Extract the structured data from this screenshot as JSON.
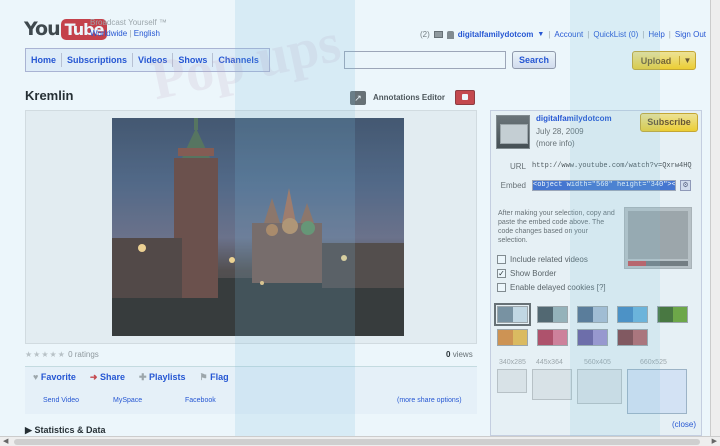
{
  "header": {
    "logo_you": "You",
    "logo_tube": "Tube",
    "tagline": "Broadcast Yourself ™",
    "locale": "Worldwide",
    "language": "English",
    "mail_count": "(2)",
    "username": "digitalfamilydotcom",
    "links": [
      "Account",
      "QuickList (0)",
      "Help",
      "Sign Out"
    ]
  },
  "nav": {
    "items": [
      "Home",
      "Subscriptions",
      "Videos",
      "Shows",
      "Channels"
    ],
    "search_placeholder": "",
    "search_label": "Search",
    "upload_label": "Upload"
  },
  "video": {
    "title": "Kremlin",
    "annotations_label": "Annotations Editor",
    "ratings": "0 ratings",
    "views_count": "0",
    "views_label": "views",
    "actions": [
      "Favorite",
      "Share",
      "Playlists",
      "Flag"
    ],
    "share_targets": [
      "Send Video",
      "MySpace",
      "Facebook"
    ],
    "more_share": "(more share options)",
    "statistics_label": "Statistics & Data"
  },
  "sidebar": {
    "owner": "digitalfamilydotcom",
    "date": "July 28, 2009",
    "more_info": "(more info)",
    "subscribe_label": "Subscribe",
    "url_label": "URL",
    "url_value": "http://www.youtube.com/watch?v=Qxrw4HQ",
    "embed_label": "Embed",
    "embed_value": "<object width=\"560\" height=\"340\"><param",
    "help_text": "After making your selection, copy and paste the embed code above. The code changes based on your selection.",
    "options": [
      {
        "label": "Include related videos",
        "checked": false
      },
      {
        "label": "Show Border",
        "checked": true
      },
      {
        "label": "Enable delayed cookies [?]",
        "checked": false
      }
    ],
    "swatches": [
      [
        "#6b7f8e",
        "#c8d8e0"
      ],
      [
        "#3a4a50",
        "#8fa8ac"
      ],
      [
        "#3e5475",
        "#a9b7cc"
      ],
      [
        "#2a74b8",
        "#58a8d8"
      ],
      [
        "#2f5e12",
        "#5d9a1c"
      ],
      [
        "#d8802a",
        "#e8b23a"
      ],
      [
        "#b02e48",
        "#d86a84"
      ],
      [
        "#5b3e8c",
        "#9c7ec4"
      ],
      [
        "#7a1e1e",
        "#b84a4a"
      ]
    ],
    "sizes": [
      "340x285",
      "445x364",
      "560x405",
      "660x525"
    ],
    "close_label": "(close)"
  },
  "colors": {
    "brand_red": "#cc181e",
    "link_blue": "#0033cc",
    "button_yellow": "#ffcc00"
  }
}
